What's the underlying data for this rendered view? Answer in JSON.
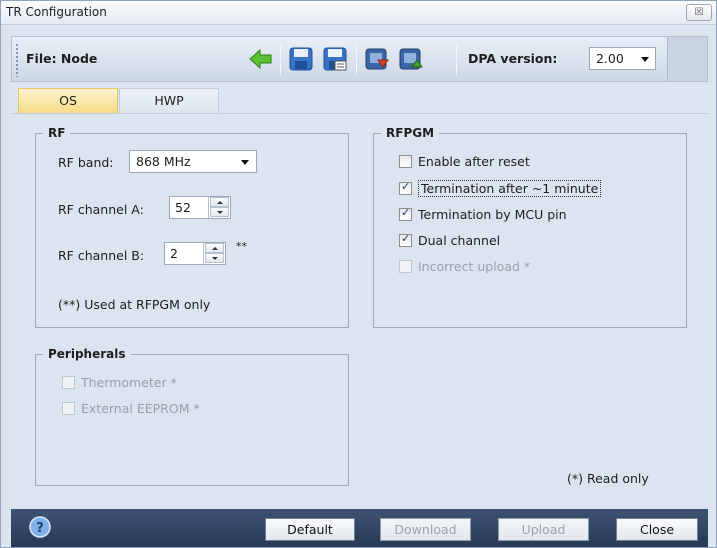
{
  "window": {
    "title": "TR Configuration",
    "close_glyph": "☒"
  },
  "toolbar": {
    "file_label": "File: Node",
    "buttons": [
      "back-arrow-icon",
      "save-icon",
      "save-as-icon",
      "download-icon",
      "upload-icon"
    ],
    "dpa_label": "DPA version:",
    "dpa_value": "2.00"
  },
  "tabs": [
    {
      "label": "OS",
      "active": true
    },
    {
      "label": "HWP",
      "active": false
    }
  ],
  "rf": {
    "legend": "RF",
    "band_label": "RF band:",
    "band_value": "868 MHz",
    "channel_a_label": "RF channel A:",
    "channel_a_value": "52",
    "channel_b_label": "RF channel B:",
    "channel_b_value": "2",
    "channel_b_mark": "**",
    "note": "(**) Used at RFPGM only"
  },
  "rfpgm": {
    "legend": "RFPGM",
    "items": [
      {
        "label": "Enable after reset",
        "checked": false,
        "enabled": true
      },
      {
        "label": "Termination after ~1 minute",
        "checked": true,
        "enabled": true
      },
      {
        "label": "Termination by MCU pin",
        "checked": true,
        "enabled": true
      },
      {
        "label": "Dual channel",
        "checked": true,
        "enabled": true
      },
      {
        "label": "Incorrect upload *",
        "checked": false,
        "enabled": false
      }
    ]
  },
  "peripherals": {
    "legend": "Peripherals",
    "items": [
      {
        "label": "Thermometer *",
        "checked": false,
        "enabled": false
      },
      {
        "label": "External EEPROM *",
        "checked": false,
        "enabled": false
      }
    ]
  },
  "read_only_note": "(*) Read only",
  "bottom": {
    "help_icon": "help-icon",
    "default_label": "Default",
    "download_label": "Download",
    "upload_label": "Upload",
    "close_label": "Close"
  },
  "colors": {
    "tab_active": "#f7dc86",
    "bottom_bar": "#2f4564",
    "accent_green": "#4caa2c",
    "accent_blue": "#2a64b8"
  }
}
